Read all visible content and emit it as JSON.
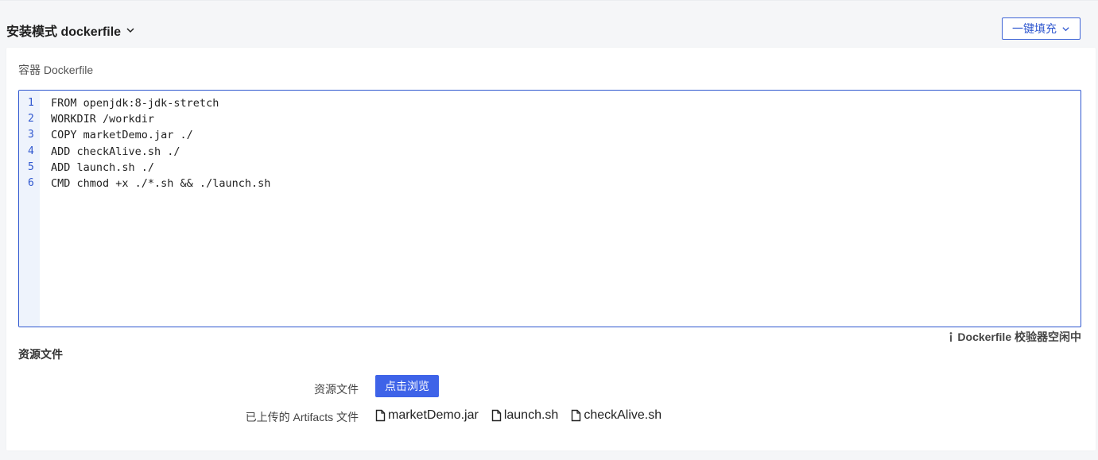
{
  "header": {
    "mode_title": "安装模式 dockerfile",
    "mode_chevron_icon": "chevron-down-icon",
    "fill_button_label": "一键填充",
    "fill_button_icon": "chevron-down-icon"
  },
  "dockerfile": {
    "section_label": "容器 Dockerfile",
    "line_numbers": [
      "1",
      "2",
      "3",
      "4",
      "5",
      "6"
    ],
    "lines": [
      "FROM openjdk:8-jdk-stretch",
      "WORKDIR /workdir",
      "COPY marketDemo.jar ./",
      "ADD checkAlive.sh ./",
      "ADD launch.sh ./",
      "CMD chmod +x ./*.sh && ./launch.sh"
    ],
    "validator_icon": "info-icon",
    "validator_status": "Dockerfile 校验器空闲中"
  },
  "resources": {
    "title": "资源文件",
    "files_label": "资源文件",
    "browse_button_label": "点击浏览",
    "uploaded_label": "已上传的 Artifacts 文件",
    "uploaded_files": [
      {
        "name": "marketDemo.jar",
        "icon": "file-icon"
      },
      {
        "name": "launch.sh",
        "icon": "file-icon"
      },
      {
        "name": "checkAlive.sh",
        "icon": "file-icon"
      }
    ]
  },
  "colors": {
    "accent": "#2f57cf",
    "primary_button": "#3e63e8",
    "gutter_bg": "#eef3fc",
    "page_bg": "#f5f6f8"
  }
}
